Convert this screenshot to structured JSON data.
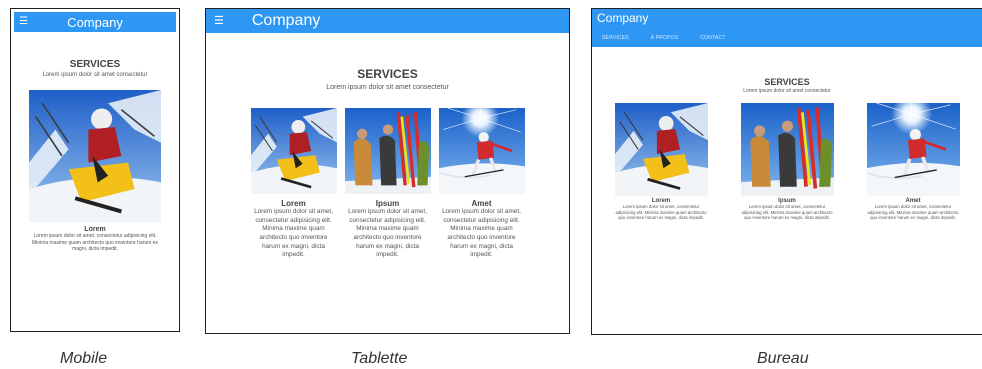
{
  "brand": "Company",
  "hamburger_icon": "menu-icon",
  "section": {
    "title": "SERVICES",
    "subtitle": "Lorem ipsum dolor sit amet consectetur"
  },
  "nav": [
    "SERVICES",
    "A PROPOS",
    "CONTACT"
  ],
  "cards": [
    {
      "title": "Lorem",
      "text": "Lorem ipsum dolor sit amet, consectetur adipisicing elit. Minima maxime quam architecto quo inventore harum ex magni, dicta impedit.",
      "image": "snowmobile-photo"
    },
    {
      "title": "Ipsum",
      "text": "Lorem ipsum dolor sit amet, consectetur adipisicing elit. Minima maxime quam architecto quo inventore harum ex magni, dicta impedit.",
      "image": "skiers-photo"
    },
    {
      "title": "Amet",
      "text": "Lorem ipsum dolor sit amet, consectetur adipisicing elit. Minima maxime quam architecto quo inventore harum ex magni, dicta impedit.",
      "image": "skier-sun-photo"
    }
  ],
  "captions": {
    "mobile": "Mobile",
    "tablet": "Tablette",
    "desktop": "Bureau"
  },
  "colors": {
    "header": "#2e97f4",
    "text": "#333333"
  }
}
